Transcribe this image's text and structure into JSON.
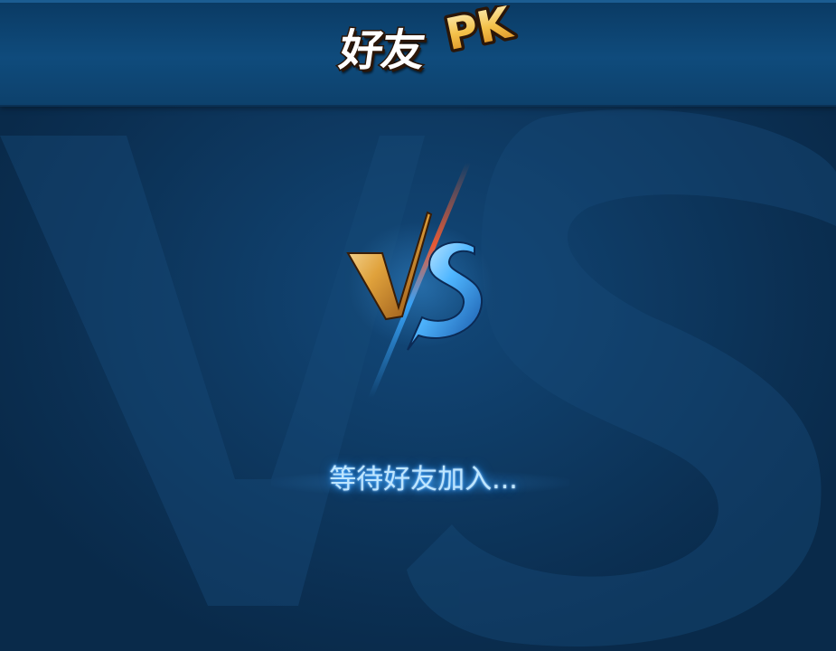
{
  "header": {
    "title": "好友",
    "title_suffix": "PK"
  },
  "status": {
    "waiting_text": "等待好友加入..."
  },
  "emblem": {
    "icon": "vs-emblem-icon",
    "text": "VS"
  },
  "colors": {
    "background": "#0d3358",
    "header": "#0f4b7c",
    "glow_text": "#bfe6ff",
    "vs_gold": "#d9a24a",
    "vs_blue": "#4fb6ff"
  }
}
